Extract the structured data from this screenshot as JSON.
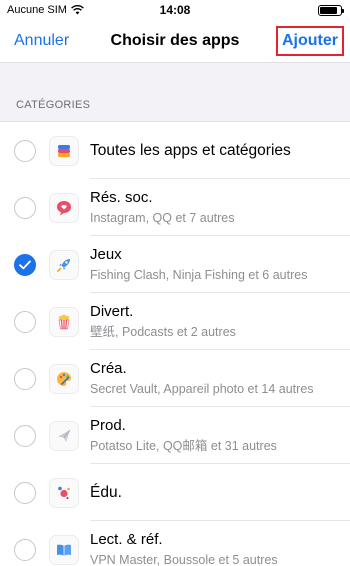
{
  "status_bar": {
    "carrier": "Aucune SIM",
    "time": "14:08",
    "battery_level": 0.85
  },
  "nav": {
    "cancel_label": "Annuler",
    "title": "Choisir des apps",
    "add_label": "Ajouter"
  },
  "section": {
    "header": "CATÉGORIES"
  },
  "items": [
    {
      "title": "Toutes les apps et catégories",
      "subtitle": "",
      "checked": false,
      "icon": "layers-icon"
    },
    {
      "title": "Rés. soc.",
      "subtitle": "Instagram, QQ et 7 autres",
      "checked": false,
      "icon": "chat-bubble-icon"
    },
    {
      "title": "Jeux",
      "subtitle": "Fishing Clash, Ninja Fishing et 6 autres",
      "checked": true,
      "icon": "rocket-icon"
    },
    {
      "title": "Divert.",
      "subtitle": "壁纸, Podcasts et 2 autres",
      "checked": false,
      "icon": "popcorn-icon"
    },
    {
      "title": "Créa.",
      "subtitle": "Secret Vault, Appareil photo et 14 autres",
      "checked": false,
      "icon": "palette-icon"
    },
    {
      "title": "Prod.",
      "subtitle": "Potatso Lite, QQ邮箱 et 31 autres",
      "checked": false,
      "icon": "paper-plane-icon"
    },
    {
      "title": "Édu.",
      "subtitle": "",
      "checked": false,
      "icon": "planet-icon"
    },
    {
      "title": "Lect. & réf.",
      "subtitle": "VPN Master, Boussole et 5 autres",
      "checked": false,
      "icon": "book-icon"
    }
  ],
  "colors": {
    "accent": "#1a73e8",
    "highlight_border": "#e0252f"
  }
}
